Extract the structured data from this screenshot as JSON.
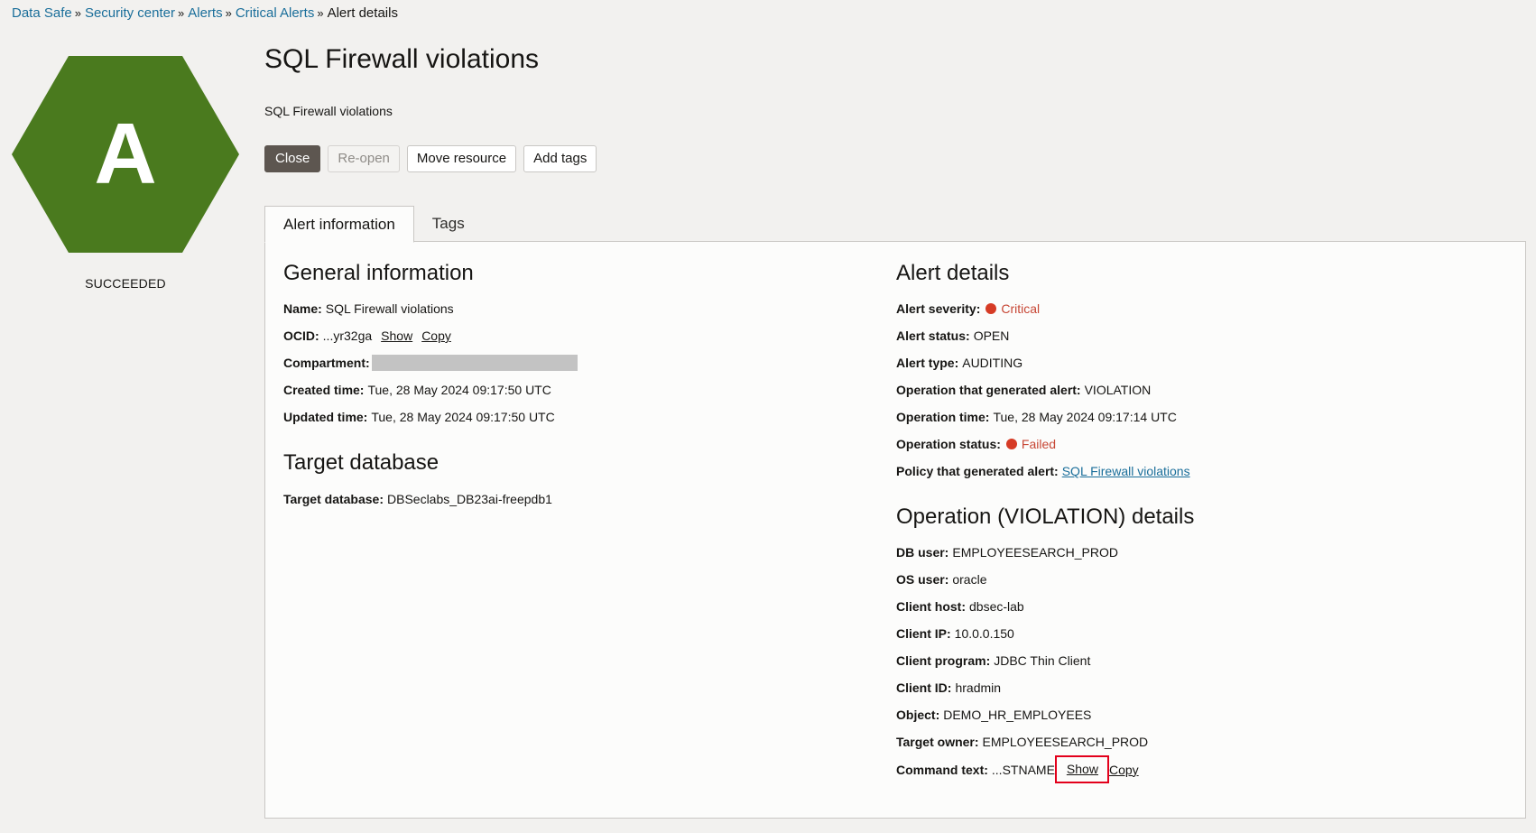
{
  "breadcrumb": {
    "items": [
      "Data Safe",
      "Security center",
      "Alerts",
      "Critical Alerts"
    ],
    "current": "Alert details",
    "separator": "»"
  },
  "badge": {
    "letter": "A",
    "color": "#4a7a1e",
    "status": "SUCCEEDED"
  },
  "header": {
    "title": "SQL Firewall violations",
    "subtitle": "SQL Firewall violations"
  },
  "actions": {
    "close": "Close",
    "reopen": "Re-open",
    "move": "Move resource",
    "add_tags": "Add tags"
  },
  "tabs": {
    "alert_info": "Alert information",
    "tags": "Tags"
  },
  "general": {
    "title": "General information",
    "name_label": "Name:",
    "name_value": "SQL Firewall violations",
    "ocid_label": "OCID:",
    "ocid_value": "...yr32ga",
    "show": "Show",
    "copy": "Copy",
    "compartment_label": "Compartment:",
    "created_label": "Created time:",
    "created_value": "Tue, 28 May 2024 09:17:50 UTC",
    "updated_label": "Updated time:",
    "updated_value": "Tue, 28 May 2024 09:17:50 UTC"
  },
  "target": {
    "title": "Target database",
    "label": "Target database:",
    "value": "DBSeclabs_DB23ai-freepdb1"
  },
  "alert": {
    "title": "Alert details",
    "severity_label": "Alert severity:",
    "severity_value": "Critical",
    "status_label": "Alert status:",
    "status_value": "OPEN",
    "type_label": "Alert type:",
    "type_value": "AUDITING",
    "operation_label": "Operation that generated alert:",
    "operation_value": "VIOLATION",
    "optime_label": "Operation time:",
    "optime_value": "Tue, 28 May 2024 09:17:14 UTC",
    "opstatus_label": "Operation status:",
    "opstatus_value": "Failed",
    "policy_label": "Policy that generated alert:",
    "policy_value": "SQL Firewall violations",
    "critical_color": "#d63b25"
  },
  "operation": {
    "title": "Operation (VIOLATION) details",
    "dbuser_label": "DB user:",
    "dbuser_value": "EMPLOYEESEARCH_PROD",
    "osuser_label": "OS user:",
    "osuser_value": "oracle",
    "host_label": "Client host:",
    "host_value": "dbsec-lab",
    "ip_label": "Client IP:",
    "ip_value": "10.0.0.150",
    "program_label": "Client program:",
    "program_value": "JDBC Thin Client",
    "clientid_label": "Client ID:",
    "clientid_value": "hradmin",
    "object_label": "Object:",
    "object_value": "DEMO_HR_EMPLOYEES",
    "owner_label": "Target owner:",
    "owner_value": "EMPLOYEESEARCH_PROD",
    "command_label": "Command text:",
    "command_value": "...STNAME",
    "show": "Show",
    "copy": "Copy"
  }
}
